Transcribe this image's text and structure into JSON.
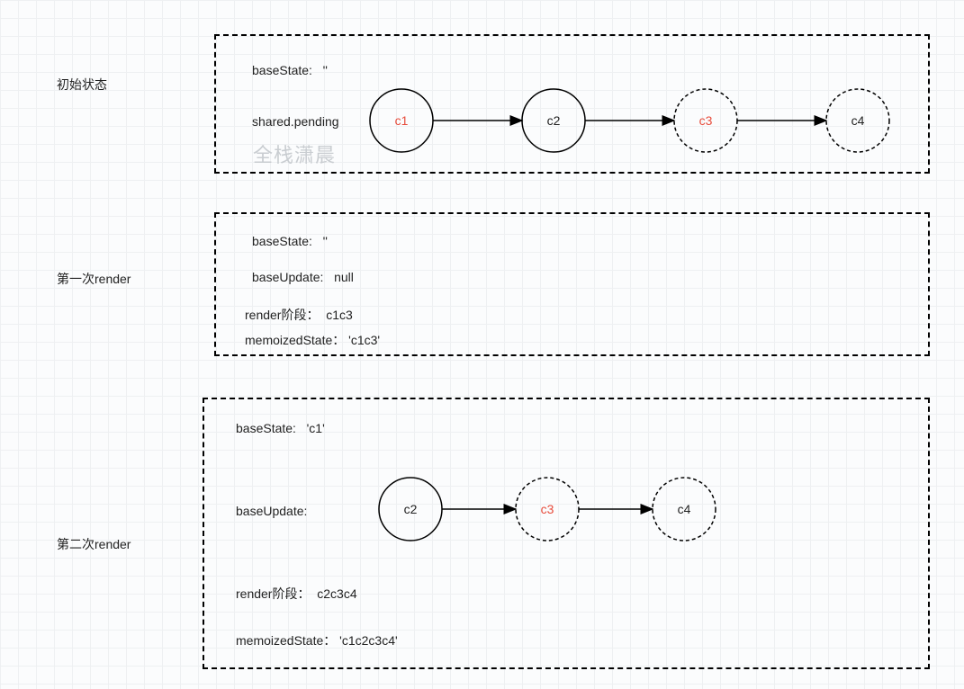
{
  "sections": {
    "initial": {
      "label": "初始状态",
      "baseState_label": "baseState:",
      "baseState_value": "''",
      "sharedPending_label": "shared.pending"
    },
    "firstRender": {
      "label": "第一次render",
      "baseState_label": "baseState:",
      "baseState_value": "''",
      "baseUpdate_label": "baseUpdate:",
      "baseUpdate_value": "null",
      "renderPhase_label": "render阶段：",
      "renderPhase_value": "c1c3",
      "memoized_label": "memoizedState：",
      "memoized_value": "'c1c3'"
    },
    "secondRender": {
      "label": "第二次render",
      "baseState_label": "baseState:",
      "baseState_value": "'c1'",
      "baseUpdate_label": "baseUpdate:",
      "renderPhase_label": "render阶段：",
      "renderPhase_value": "c2c3c4",
      "memoized_label": "memoizedState：",
      "memoized_value": "'c1c2c3c4'"
    }
  },
  "nodes": {
    "initial": [
      {
        "name": "c1",
        "highlight": true,
        "dashed": false
      },
      {
        "name": "c2",
        "highlight": false,
        "dashed": false
      },
      {
        "name": "c3",
        "highlight": true,
        "dashed": true
      },
      {
        "name": "c4",
        "highlight": false,
        "dashed": true
      }
    ],
    "second": [
      {
        "name": "c2",
        "highlight": false,
        "dashed": false
      },
      {
        "name": "c3",
        "highlight": true,
        "dashed": true
      },
      {
        "name": "c4",
        "highlight": false,
        "dashed": true
      }
    ]
  },
  "watermark": "全栈潇晨"
}
